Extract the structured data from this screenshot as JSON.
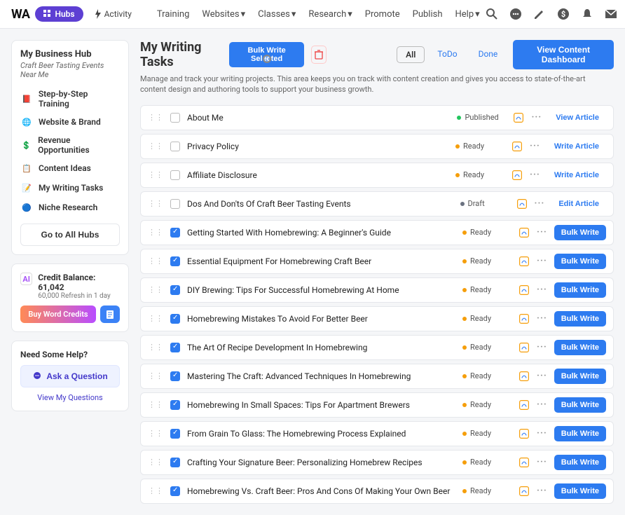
{
  "top": {
    "logo": "WA",
    "hubs": "Hubs",
    "activity": "Activity",
    "nav": [
      "Training",
      "Websites",
      "Classes",
      "Research",
      "Promote",
      "Publish",
      "Help"
    ]
  },
  "hub": {
    "title": "My Business Hub",
    "subtitle": "Craft Beer Tasting Events Near Me",
    "items": [
      {
        "icon": "📕",
        "label": "Step-by-Step Training"
      },
      {
        "icon": "🌐",
        "label": "Website & Brand"
      },
      {
        "icon": "💲",
        "label": "Revenue Opportunities"
      },
      {
        "icon": "📋",
        "label": "Content Ideas"
      },
      {
        "icon": "📝",
        "label": "My Writing Tasks"
      },
      {
        "icon": "🔵",
        "label": "Niche Research"
      }
    ],
    "allHubs": "Go to All Hubs"
  },
  "credits": {
    "ai": "AI",
    "label": "Credit Balance: 61,042",
    "sub": "60,000 Refresh in 1 day",
    "buy": "Buy Word Credits"
  },
  "help": {
    "title": "Need Some Help?",
    "ask": "Ask a Question",
    "view": "View My Questions"
  },
  "page": {
    "title": "My Writing Tasks",
    "bulkWrite": "Bulk Write Selected",
    "filters": {
      "all": "All",
      "todo": "ToDo",
      "done": "Done"
    },
    "viewDash": "View Content Dashboard",
    "subtitle": "Manage and track your writing projects. This area keeps you on track with content creation and gives you access to state-of-the-art content design and authoring tools to support your business growth."
  },
  "actions": {
    "viewArticle": "View Article",
    "writeArticle": "Write Article",
    "editArticle": "Edit Article",
    "bulkWrite": "Bulk Write"
  },
  "tasks": [
    {
      "title": "About Me",
      "checked": false,
      "status": "Published",
      "dot": "green",
      "action": "viewArticle",
      "style": "link"
    },
    {
      "title": "Privacy Policy",
      "checked": false,
      "status": "Ready",
      "dot": "yellow",
      "action": "writeArticle",
      "style": "link"
    },
    {
      "title": "Affiliate Disclosure",
      "checked": false,
      "status": "Ready",
      "dot": "yellow",
      "action": "writeArticle",
      "style": "link"
    },
    {
      "title": "Dos And Don'ts Of Craft Beer Tasting Events",
      "checked": false,
      "status": "Draft",
      "dot": "gray",
      "action": "editArticle",
      "style": "link"
    },
    {
      "title": "Getting Started With Homebrewing: A Beginner's Guide",
      "checked": true,
      "status": "Ready",
      "dot": "yellow",
      "action": "bulkWrite",
      "style": "primary"
    },
    {
      "title": "Essential Equipment For Homebrewing Craft Beer",
      "checked": true,
      "status": "Ready",
      "dot": "yellow",
      "action": "bulkWrite",
      "style": "primary"
    },
    {
      "title": "DIY Brewing: Tips For Successful Homebrewing At Home",
      "checked": true,
      "status": "Ready",
      "dot": "yellow",
      "action": "bulkWrite",
      "style": "primary"
    },
    {
      "title": "Homebrewing Mistakes To Avoid For Better Beer",
      "checked": true,
      "status": "Ready",
      "dot": "yellow",
      "action": "bulkWrite",
      "style": "primary"
    },
    {
      "title": "The Art Of Recipe Development In Homebrewing",
      "checked": true,
      "status": "Ready",
      "dot": "yellow",
      "action": "bulkWrite",
      "style": "primary"
    },
    {
      "title": "Mastering The Craft: Advanced Techniques In Homebrewing",
      "checked": true,
      "status": "Ready",
      "dot": "yellow",
      "action": "bulkWrite",
      "style": "primary"
    },
    {
      "title": "Homebrewing In Small Spaces: Tips For Apartment Brewers",
      "checked": true,
      "status": "Ready",
      "dot": "yellow",
      "action": "bulkWrite",
      "style": "primary"
    },
    {
      "title": "From Grain To Glass: The Homebrewing Process Explained",
      "checked": true,
      "status": "Ready",
      "dot": "yellow",
      "action": "bulkWrite",
      "style": "primary"
    },
    {
      "title": "Crafting Your Signature Beer: Personalizing Homebrew Recipes",
      "checked": true,
      "status": "Ready",
      "dot": "yellow",
      "action": "bulkWrite",
      "style": "primary"
    },
    {
      "title": "Homebrewing Vs. Craft Beer: Pros And Cons Of Making Your Own Beer",
      "checked": true,
      "status": "Ready",
      "dot": "yellow",
      "action": "bulkWrite",
      "style": "primary"
    }
  ]
}
